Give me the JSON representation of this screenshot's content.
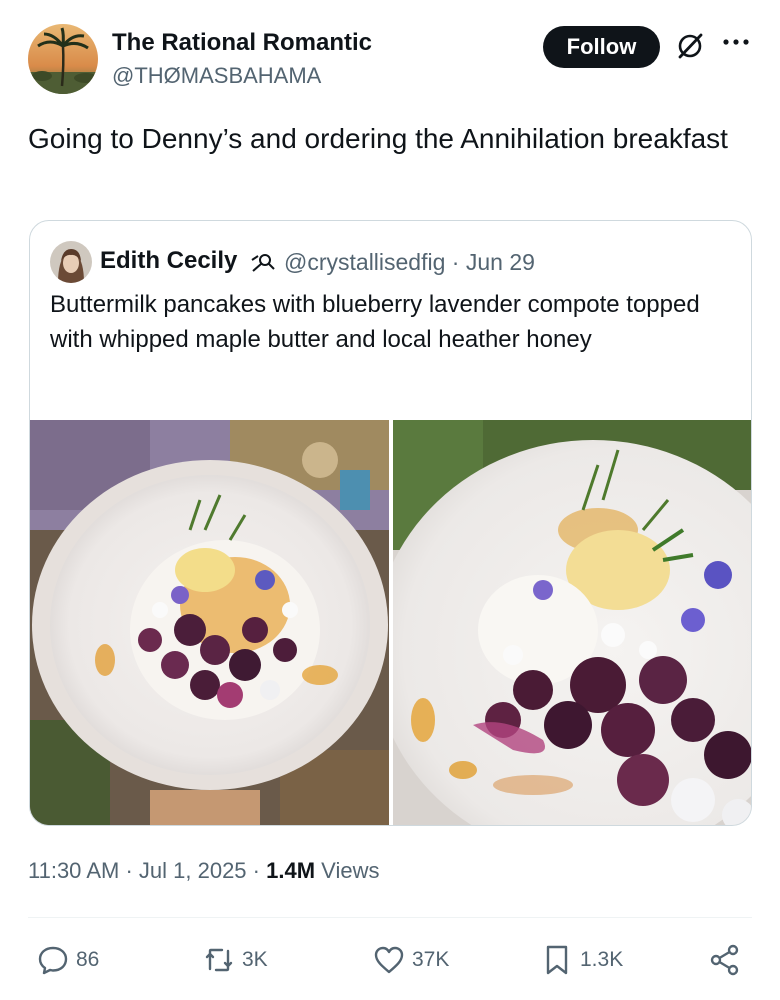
{
  "post": {
    "author_name": "The Rational Romantic",
    "author_handle": "@THØMASBAHAMA",
    "follow_label": "Follow",
    "grok_icon": "grok-icon",
    "more_icon": "more-icon",
    "text": "Going to Denny’s and ordering the Annihilation breakfast"
  },
  "quoted": {
    "author_name": "Edith Cecily",
    "badge_icon": "thread-badge-icon",
    "handle": "@crystallisedfig",
    "separator": "·",
    "date": "Jun 29",
    "text": "Buttermilk pancakes with blueberry lavender compote topped with whipped maple butter and local heather honey",
    "images": [
      {
        "name": "pancake-photo-1"
      },
      {
        "name": "pancake-photo-2"
      }
    ]
  },
  "meta": {
    "time": "11:30 AM",
    "date": "Jul 1, 2025",
    "views_count": "1.4M",
    "views_label": "Views",
    "separator": "·"
  },
  "actions": {
    "replies": "86",
    "reposts": "3K",
    "likes": "37K",
    "bookmarks": "1.3K",
    "share_icon": "share-icon"
  },
  "colors": {
    "text_primary": "#0f1419",
    "text_secondary": "#536471",
    "border": "#cfd9de",
    "follow_bg": "#0f1419"
  }
}
